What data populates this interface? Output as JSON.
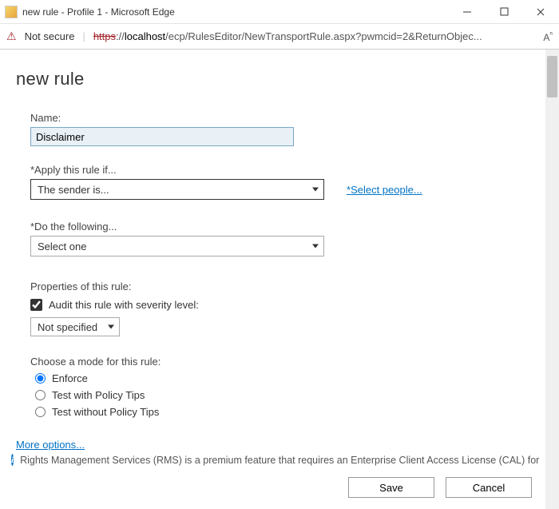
{
  "window": {
    "title": "new rule - Profile 1 - Microsoft Edge"
  },
  "address": {
    "not_secure": "Not secure",
    "protocol": "https",
    "sep": "://",
    "host": "localhost",
    "path": "/ecp/RulesEditor/NewTransportRule.aspx?pwmcid=2&ReturnObjec..."
  },
  "page": {
    "heading": "new rule",
    "name_label": "Name:",
    "name_value": "Disclaimer",
    "apply_label": "*Apply this rule if...",
    "apply_value": "The sender is...",
    "select_people": "Select people...",
    "do_label": "*Do the following...",
    "do_value": "Select one",
    "properties_label": "Properties of this rule:",
    "audit_label": "Audit this rule with severity level:",
    "audit_checked": true,
    "severity_value": "Not specified",
    "mode_label": "Choose a mode for this rule:",
    "modes": {
      "enforce": "Enforce",
      "test_tips": "Test with Policy Tips",
      "test_no_tips": "Test without Policy Tips"
    },
    "more_options": "More options...",
    "rms_text": "Rights Management Services (RMS) is a premium feature that requires an Enterprise Client Access License (CAL) for each",
    "save_label": "Save",
    "cancel_label": "Cancel"
  }
}
